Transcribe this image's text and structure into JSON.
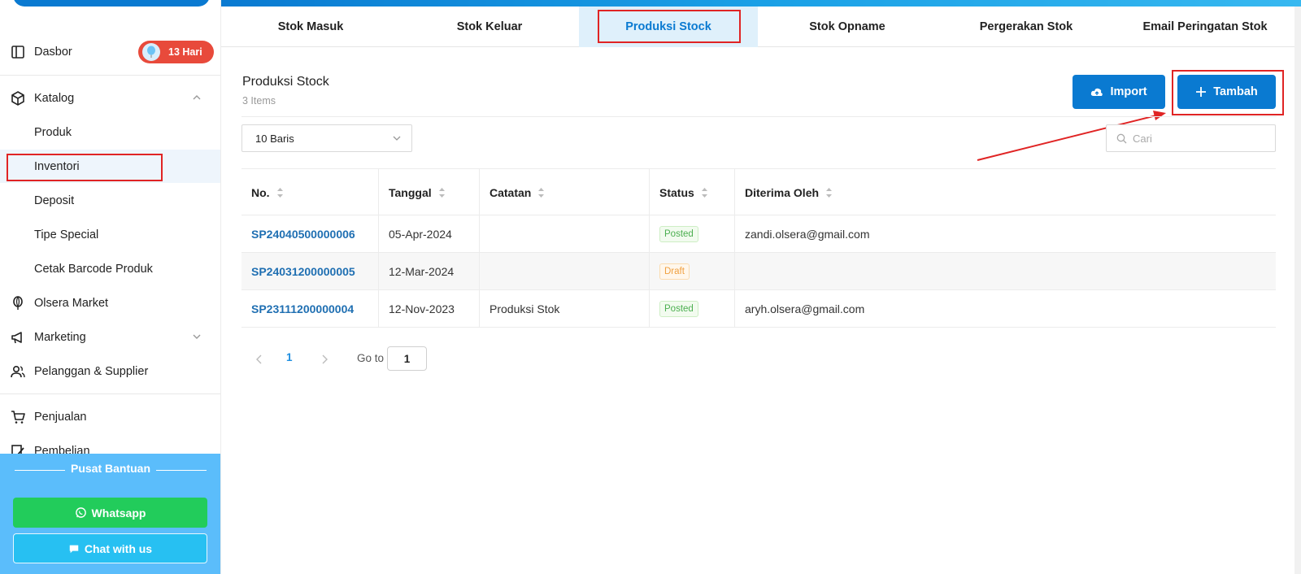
{
  "sidebar": {
    "dashboard": {
      "label": "Dasbor",
      "badge": "13 Hari"
    },
    "catalog": {
      "label": "Katalog",
      "children": [
        "Produk",
        "Inventori",
        "Deposit",
        "Tipe Special",
        "Cetak Barcode Produk"
      ]
    },
    "olsera_market": "Olsera Market",
    "marketing": "Marketing",
    "customers": "Pelanggan & Supplier",
    "sales": "Penjualan",
    "purchases": "Pembelian",
    "active_item": "Inventori"
  },
  "help": {
    "title": "Pusat Bantuan",
    "whatsapp": "Whatsapp",
    "chat": "Chat with us"
  },
  "tabs": [
    "Stok Masuk",
    "Stok Keluar",
    "Produksi Stock",
    "Stok Opname",
    "Pergerakan Stok",
    "Email Peringatan Stok"
  ],
  "active_tab": "Produksi Stock",
  "page": {
    "title": "Produksi Stock",
    "count": "3 Items",
    "import_label": "Import",
    "add_label": "Tambah",
    "rows_select": "10 Baris",
    "search_placeholder": "Cari"
  },
  "table": {
    "columns": [
      "No.",
      "Tanggal",
      "Catatan",
      "Status",
      "Diterima Oleh"
    ],
    "rows": [
      {
        "no": "SP24040500000006",
        "date": "05-Apr-2024",
        "note": "",
        "status": "Posted",
        "received_by": "zandi.olsera@gmail.com"
      },
      {
        "no": "SP24031200000005",
        "date": "12-Mar-2024",
        "note": "",
        "status": "Draft",
        "received_by": ""
      },
      {
        "no": "SP23111200000004",
        "date": "12-Nov-2023",
        "note": "Produksi Stok",
        "status": "Posted",
        "received_by": "aryh.olsera@gmail.com"
      }
    ]
  },
  "pagination": {
    "current": "1",
    "goto_label": "Go to",
    "goto_value": "1"
  },
  "colors": {
    "primary": "#0a7ad1",
    "highlight": "#e02424",
    "whatsapp": "#22cc5b",
    "chat": "#27c0f2",
    "help_bg": "#5bbdfb"
  }
}
